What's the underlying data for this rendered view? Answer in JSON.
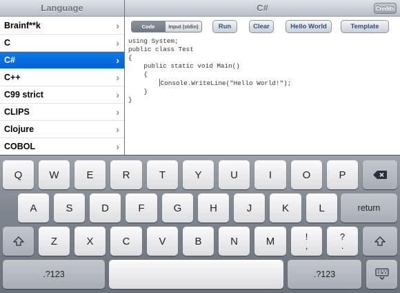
{
  "left_nav": {
    "title": "Language"
  },
  "right_nav": {
    "title": "C#",
    "credits_label": "Credits"
  },
  "languages": [
    {
      "label": "Brainf**k",
      "selected": false
    },
    {
      "label": "C",
      "selected": false
    },
    {
      "label": "C#",
      "selected": true
    },
    {
      "label": "C++",
      "selected": false
    },
    {
      "label": "C99 strict",
      "selected": false
    },
    {
      "label": "CLIPS",
      "selected": false
    },
    {
      "label": "Clojure",
      "selected": false
    },
    {
      "label": "COBOL",
      "selected": false
    }
  ],
  "toolbar": {
    "segment_code": "Code",
    "segment_input": "Input (stdin)",
    "run": "Run",
    "clear": "Clear",
    "hello_world": "Hello World",
    "template": "Template"
  },
  "code_lines": [
    "using System;",
    "public class Test",
    "{",
    "    public static void Main()",
    "    {",
    "        Console.WriteLine(\"Hello World!\");",
    "    }",
    "}"
  ],
  "keyboard": {
    "row1": [
      "Q",
      "W",
      "E",
      "R",
      "T",
      "Y",
      "U",
      "I",
      "O",
      "P"
    ],
    "row2": [
      "A",
      "S",
      "D",
      "F",
      "G",
      "H",
      "J",
      "K",
      "L"
    ],
    "row3": [
      "Z",
      "X",
      "C",
      "V",
      "B",
      "N",
      "M"
    ],
    "return_label": "return",
    "punct1": [
      "!",
      ","
    ],
    "punct2": [
      "?",
      "."
    ],
    "numbers_label": ".?123",
    "icons": {
      "backspace": "backspace-icon",
      "shift": "shift-icon",
      "dismiss": "keyboard-dismiss-icon"
    }
  },
  "colors": {
    "selection": "#0a6fe3",
    "toolbar_text": "#2f4e80",
    "cursor": "#2a67d8"
  }
}
